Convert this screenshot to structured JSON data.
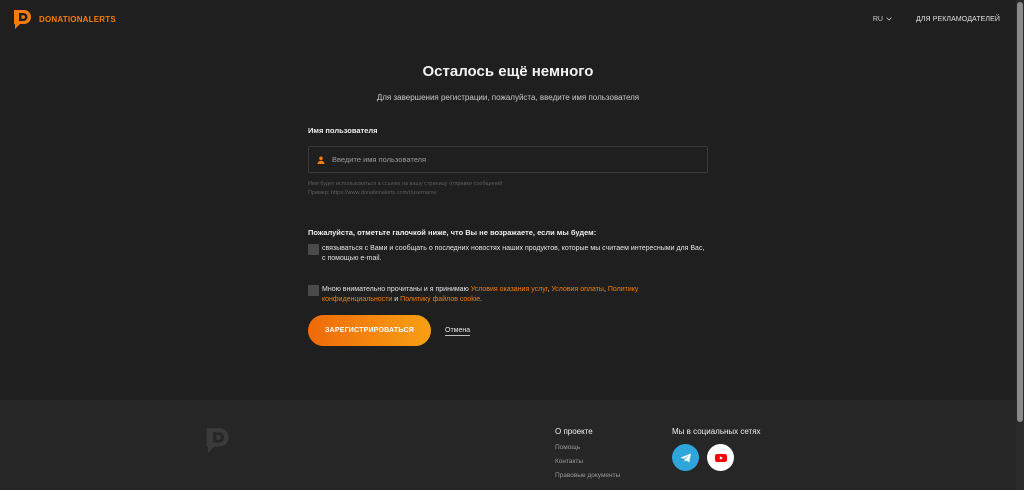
{
  "header": {
    "logo_text": "DONATIONALERTS",
    "lang": "RU",
    "advertisers_link": "ДЛЯ РЕКЛАМОДАТЕЛЕЙ"
  },
  "main": {
    "title": "Осталось ещё немного",
    "subtitle": "Для завершения регистрации, пожалуйста, введите имя пользователя",
    "username_label": "Имя пользователя",
    "username_placeholder": "Введите имя пользователя",
    "username_value": "",
    "hint_line1": "Имя будет использоваться в ссылке на вашу страницу отправки сообщений",
    "hint_line2": "Пример: https://www.donationalerts.com/r/username",
    "consent_title": "Пожалуйста, отметьте галочкой ниже, что Вы не возражаете, если мы будем:",
    "consent_news": "связываться с Вами и сообщать о последних новостях наших продуктов, которые мы считаем интересными для Вас, с помощью e-mail.",
    "consent_terms_prefix": "Мною внимательно прочитаны и я принимаю ",
    "terms_link": "Условия оказания услуг",
    "sep1": ", ",
    "payment_link": "Условия оплаты",
    "sep2": ", ",
    "privacy_link": "Политику конфиденциальности",
    "sep3": " и ",
    "cookie_link": "Политику файлов cookie",
    "end": ".",
    "register_button": "ЗАРЕГИСТРИРОВАТЬСЯ",
    "cancel_button": "Отмена"
  },
  "footer": {
    "about_title": "О проекте",
    "about_links": [
      "Помощь",
      "Контакты",
      "Правовые документы"
    ],
    "social_title": "Мы в социальных сетях"
  },
  "colors": {
    "accent": "#f57d07",
    "background": "#1f1f1f",
    "telegram": "#2ea6dc",
    "youtube": "#ff0000"
  },
  "icons": [
    "logo-icon",
    "chevron-down-icon",
    "user-icon",
    "telegram-icon",
    "youtube-icon"
  ]
}
